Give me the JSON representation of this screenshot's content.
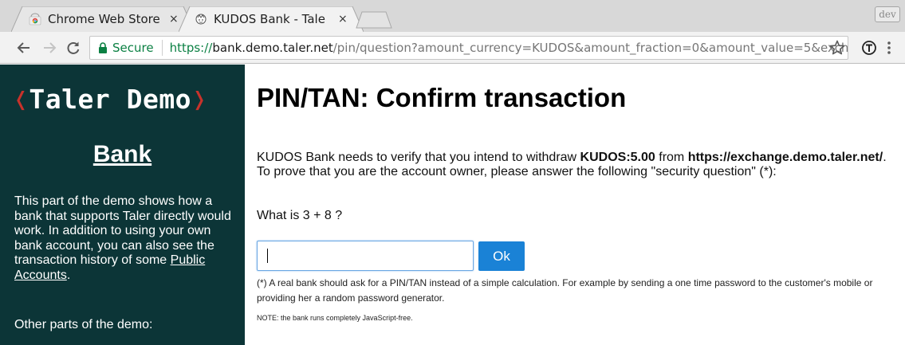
{
  "browser": {
    "tabs": [
      {
        "title": "Chrome Web Store",
        "close": "×",
        "active": false,
        "favicon": "chrome-web-store-icon"
      },
      {
        "title": "KUDOS Bank - Tale",
        "close": "×",
        "active": true,
        "favicon": "taler-bank-icon"
      }
    ],
    "profile_badge": "dev",
    "omnibox": {
      "security_label": "Secure",
      "url_scheme": "https://",
      "url_host": "bank.demo.taler.net",
      "url_path": "/pin/question?amount_currency=KUDOS&amount_fraction=0&amount_value=5&excha..."
    },
    "icons": {
      "back": "back-arrow-icon",
      "forward": "forward-arrow-icon",
      "reload": "reload-icon",
      "lock": "lock-icon",
      "bookmark": "star-icon",
      "extension": "taler-extension-icon",
      "menu": "kebab-menu-icon"
    }
  },
  "sidebar": {
    "logo_open": "❬",
    "logo_text": "Taler Demo",
    "logo_close": "❭",
    "bank_link": "Bank",
    "description_pre": "This part of the demo shows how a bank that supports Taler directly would work. In addition to using your own bank account, you can also see the transaction history of some ",
    "public_accounts_link": "Public Accounts",
    "description_post": ".",
    "other_parts": "Other parts of the demo:"
  },
  "main": {
    "title": "PIN/TAN: Confirm transaction",
    "intro_1": "KUDOS Bank needs to verify that you intend to withdraw ",
    "amount": "KUDOS:5.00",
    "intro_2": " from ",
    "exchange_url": "https://exchange.demo.taler.net/",
    "intro_3": ". To prove that you are the account owner, please answer the following \"security question\" (*):",
    "question": "What is 3 + 8 ?",
    "answer_value": "",
    "ok_label": "Ok",
    "footnote": "(*) A real bank should ask for a PIN/TAN instead of a simple calculation. For example by sending a one time password to the customer's mobile or providing her a random password generator.",
    "note": "NOTE: the bank runs completely JavaScript-free."
  },
  "colors": {
    "sidebar_bg": "#0c3537",
    "logo_bracket": "#c8322b",
    "ok_button": "#1a82d6",
    "secure_green": "#0b8043"
  }
}
